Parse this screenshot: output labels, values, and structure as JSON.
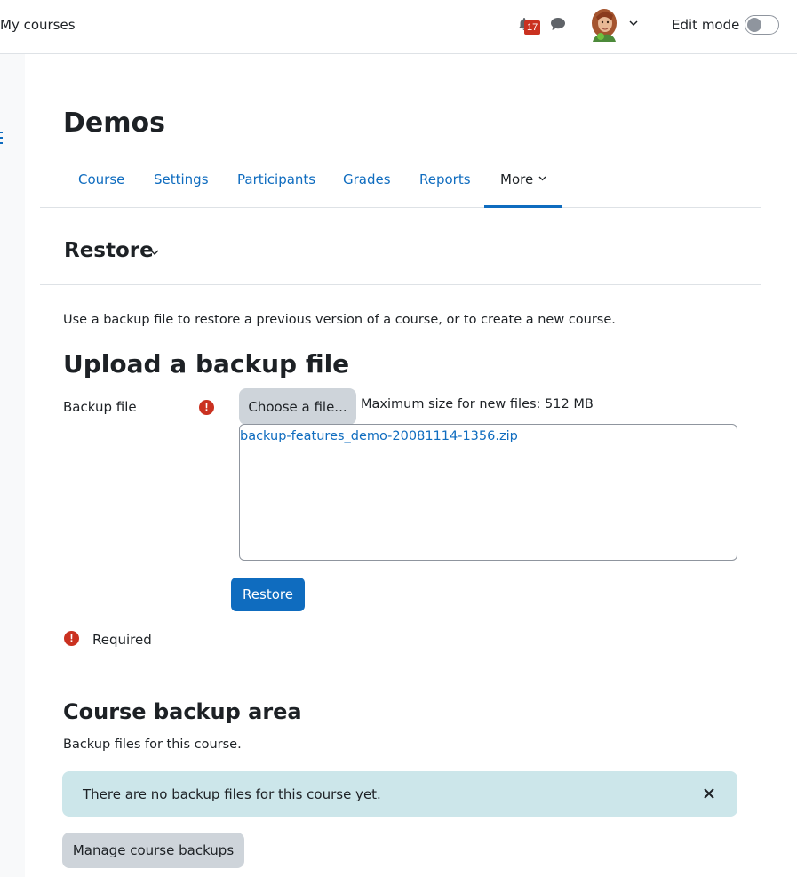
{
  "navbar": {
    "my_courses": "My courses",
    "notification_count": "17",
    "edit_mode_label": "Edit mode"
  },
  "page": {
    "title": "Demos"
  },
  "secondary_nav": {
    "tabs": [
      {
        "label": "Course"
      },
      {
        "label": "Settings"
      },
      {
        "label": "Participants"
      },
      {
        "label": "Grades"
      },
      {
        "label": "Reports"
      },
      {
        "label": "More"
      }
    ],
    "active_tab": "More"
  },
  "restore": {
    "heading": "Restore",
    "intro": "Use a backup file to restore a previous version of a course, or to create a new course.",
    "upload_heading": "Upload a backup file",
    "backup_file_label": "Backup file",
    "choose_button": "Choose a file...",
    "max_size": "Maximum size for new files: 512 MB",
    "selected_file": "backup-features_demo-20081114-1356.zip",
    "restore_button": "Restore",
    "required_label": "Required"
  },
  "backup_area": {
    "heading": "Course backup area",
    "subtitle": "Backup files for this course.",
    "alert_text": "There are no backup files for this course yet.",
    "manage_button": "Manage course backups"
  },
  "colors": {
    "primary": "#0f6cbf",
    "danger": "#ca3120",
    "alert_bg": "#cce6ea",
    "secondary_btn": "#ced4da"
  },
  "icons": {
    "bell": "bell-icon",
    "chat": "chat-icon",
    "avatar": "avatar",
    "required": "exclamation-circle-icon",
    "close": "close-icon"
  }
}
